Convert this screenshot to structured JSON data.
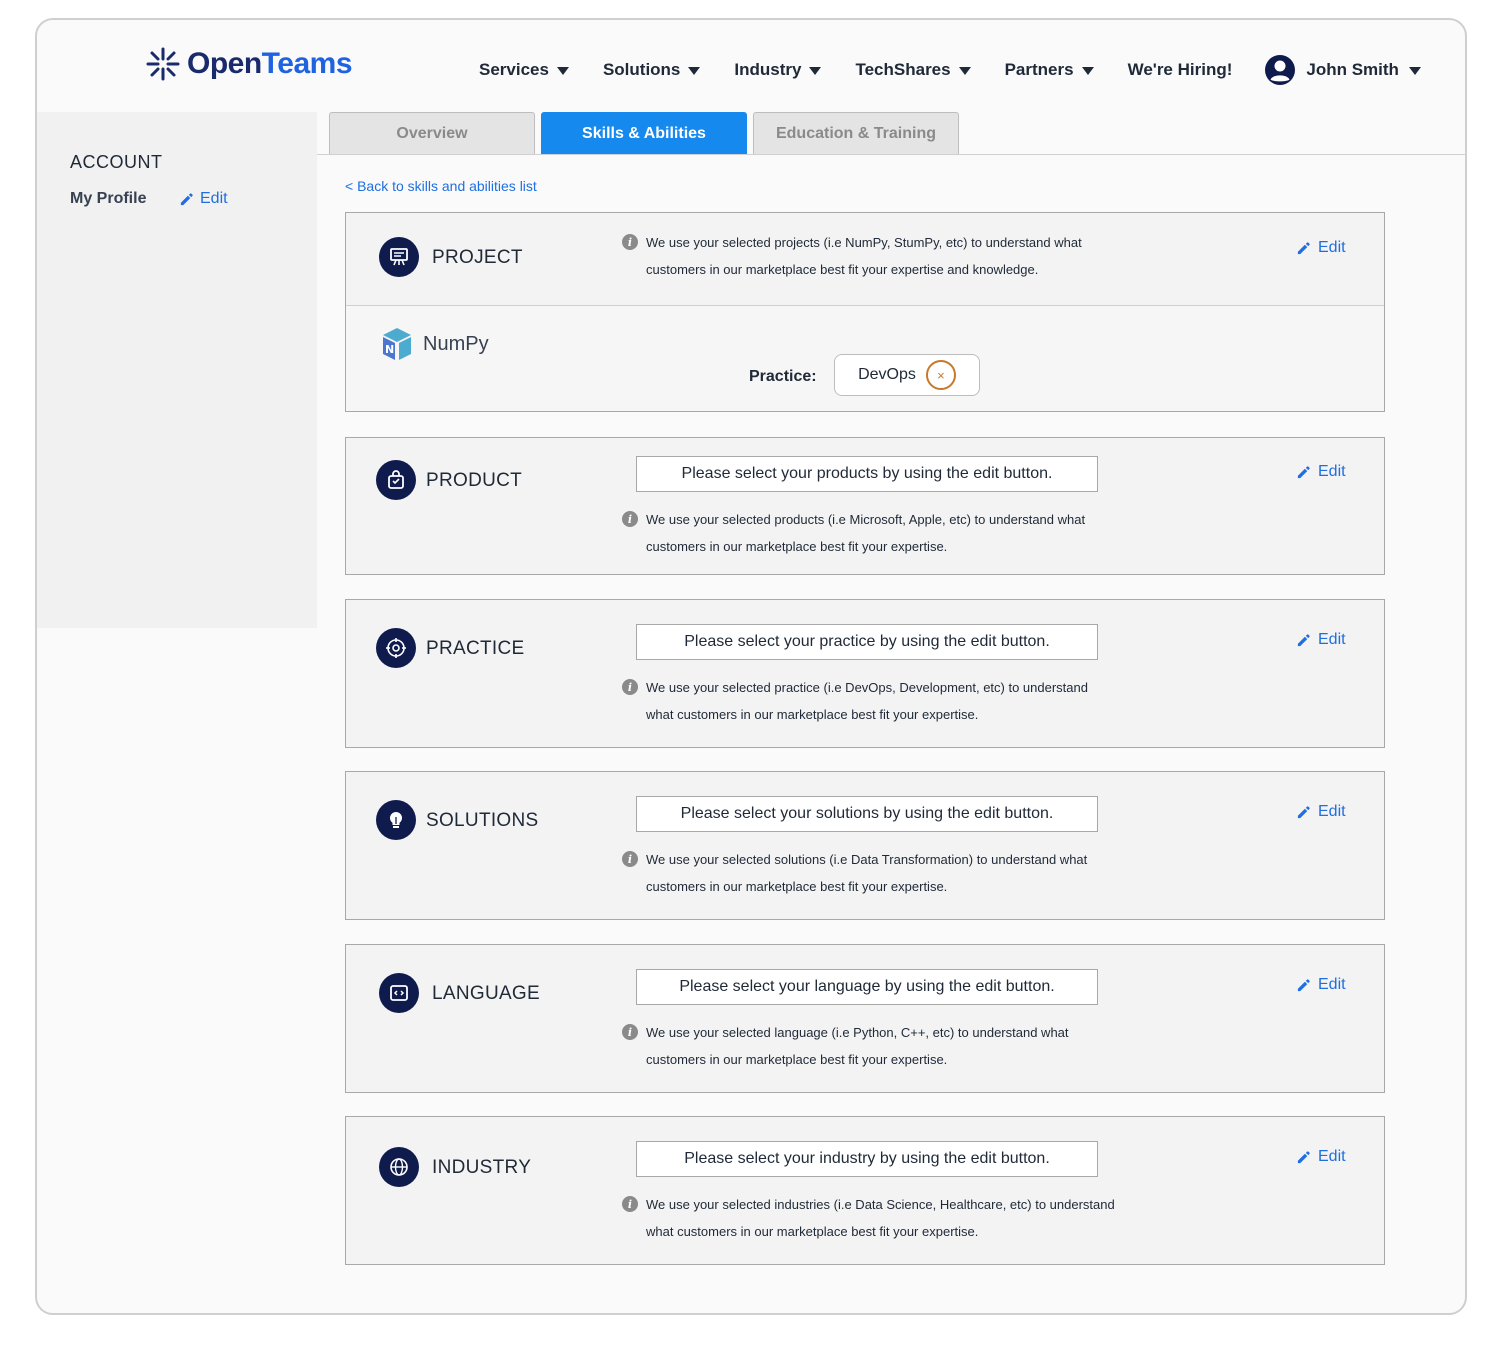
{
  "header": {
    "logo_open": "Open",
    "logo_teams": "Teams",
    "nav": [
      "Services",
      "Solutions",
      "Industry",
      "TechShares",
      "Partners"
    ],
    "hiring": "We're Hiring!",
    "user_name": "John Smith"
  },
  "sidebar": {
    "title": "ACCOUNT",
    "profile": "My Profile",
    "edit": "Edit"
  },
  "tabs": [
    "Overview",
    "Skills & Abilities",
    "Education & Training"
  ],
  "active_tab": "Skills & Abilities",
  "back_link": "< Back to skills and abilities list",
  "edit_label": "Edit",
  "project": {
    "title": "PROJECT",
    "info": "We use your selected projects (i.e NumPy, StumPy, etc) to understand what customers in our marketplace best fit your expertise and knowledge.",
    "item": "NumPy",
    "practice_label": "Practice:",
    "practice_value": "DevOps"
  },
  "sections": [
    {
      "title": "PRODUCT",
      "prompt": "Please select your products by using the edit button.",
      "info": "We use your selected products (i.e Microsoft, Apple, etc) to understand what customers in our marketplace best fit your expertise.",
      "icon": "bag-icon"
    },
    {
      "title": "PRACTICE",
      "prompt": "Please select your practice by using the edit button.",
      "info": "We use your selected practice (i.e DevOps, Development, etc) to understand what customers in our marketplace best fit your expertise.",
      "icon": "gear-target-icon"
    },
    {
      "title": "SOLUTIONS",
      "prompt": "Please select your solutions by using the edit button.",
      "info": "We use your selected solutions (i.e Data Transformation) to understand what customers in our marketplace best fit your expertise.",
      "icon": "lightbulb-icon"
    },
    {
      "title": "LANGUAGE",
      "prompt": "Please select your language by using the edit button.",
      "info": "We use your selected language (i.e Python, C++, etc) to understand what customers in our marketplace best fit your expertise.",
      "icon": "code-window-icon"
    },
    {
      "title": "INDUSTRY",
      "prompt": "Please select your industry by using the edit button.",
      "info": "We use your selected industries (i.e Data Science, Healthcare, etc) to understand what customers in our marketplace best fit your expertise.",
      "icon": "globe-icon"
    }
  ],
  "colors": {
    "accent": "#1589ee",
    "link": "#1f6fe0",
    "icon_bg": "#0f1b4d",
    "remove": "#c8782a"
  }
}
